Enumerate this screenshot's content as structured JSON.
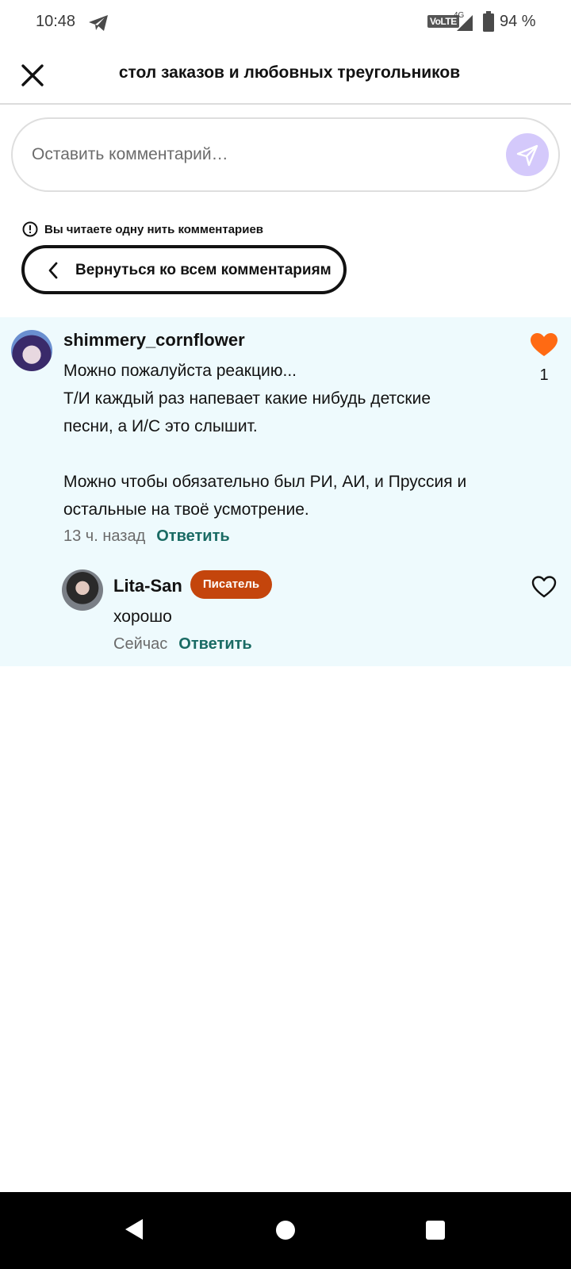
{
  "status_bar": {
    "time": "10:48",
    "volte": "VoLTE",
    "network": "4G",
    "battery": "94 %"
  },
  "header": {
    "title": "стол заказов и любовных треугольников"
  },
  "comment_box": {
    "placeholder": "Оставить комментарий…",
    "send_color": "#d4c9fb"
  },
  "thread": {
    "notice": "Вы читаете одну нить комментариев",
    "back_label": "Вернуться ко всем комментариям",
    "background": "#eefafd"
  },
  "comments": [
    {
      "username": "shimmery_cornflower",
      "lines": [
        "Можно пожалуйста реакцию...",
        "Т/И каждый раз напевает какие нибудь детские",
        "песни, а И/С это слышит.",
        "",
        "Можно чтобы обязательно был РИ, АИ, и Пруссия и",
        "остальные на твоё усмотрение."
      ],
      "time": "13 ч. назад",
      "reply": "Ответить",
      "likes": "1",
      "liked": true
    },
    {
      "username": "Lita-San",
      "badge": "Писатель",
      "text": "хорошо",
      "time": "Сейчас",
      "reply": "Ответить",
      "liked": false
    }
  ],
  "colors": {
    "like_active": "#ff6a13",
    "reply_link": "#1a6b64",
    "badge": "#c4450c"
  }
}
